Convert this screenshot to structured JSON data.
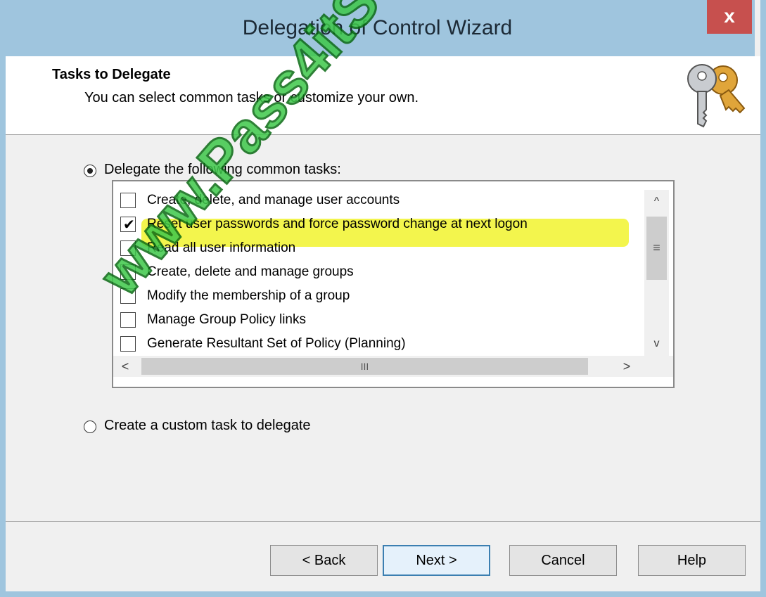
{
  "window": {
    "title": "Delegation of Control Wizard",
    "close_label": "x"
  },
  "header": {
    "title": "Tasks to Delegate",
    "subtitle": "You can select common tasks or customize your own."
  },
  "options": {
    "common_label": "Delegate the following common tasks:",
    "custom_label": "Create a custom task to delegate",
    "selected": "common"
  },
  "tasks": [
    {
      "label": "Create, delete, and manage user accounts",
      "checked": false
    },
    {
      "label": "Reset user passwords and force password change at next logon",
      "checked": true
    },
    {
      "label": "Read all user information",
      "checked": false
    },
    {
      "label": "Create, delete and manage groups",
      "checked": false
    },
    {
      "label": "Modify the membership of a group",
      "checked": false
    },
    {
      "label": "Manage Group Policy links",
      "checked": false
    },
    {
      "label": "Generate Resultant Set of Policy (Planning)",
      "checked": false
    }
  ],
  "scrollbar": {
    "up": "^",
    "down": "v",
    "grip_v": "≡",
    "left": "<",
    "right": ">",
    "grip_h": "III"
  },
  "buttons": {
    "back": "< Back",
    "next": "Next >",
    "cancel": "Cancel",
    "help": "Help"
  },
  "watermark": "www.Pass4itSure.com",
  "colors": {
    "titlebar": "#9fc5de",
    "close": "#c7504e",
    "highlight": "#f2f43a",
    "watermark": "#3ec84a"
  },
  "icons": {
    "header_image": "keys-icon"
  }
}
